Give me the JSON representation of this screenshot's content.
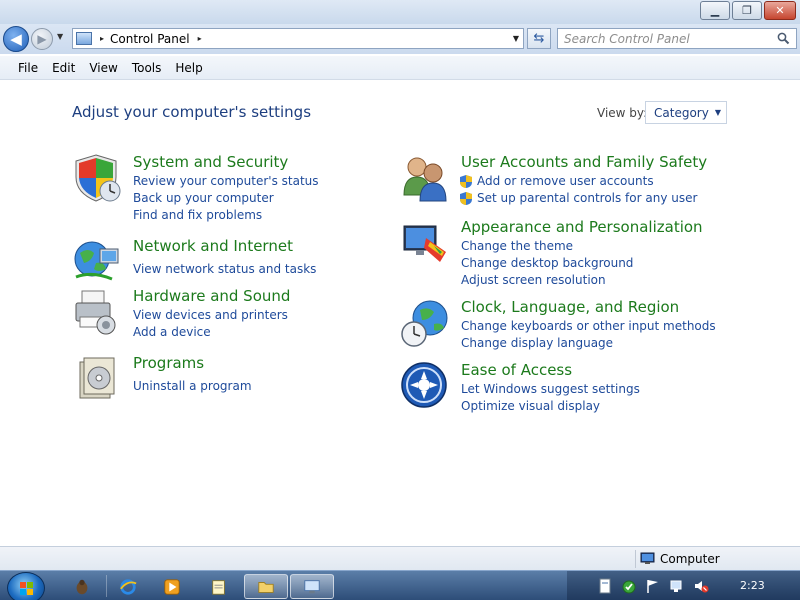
{
  "window": {
    "minimize_glyph": "▁",
    "maximize_glyph": "❐",
    "close_glyph": "✕"
  },
  "navigation": {
    "back_glyph": "◀",
    "forward_glyph": "▶",
    "breadcrumb_separator": "▸",
    "address_text": "Control Panel",
    "refresh_glyph": "⇆",
    "search_placeholder": "Search Control Panel"
  },
  "menu": {
    "items": [
      {
        "label": "File"
      },
      {
        "label": "Edit"
      },
      {
        "label": "View"
      },
      {
        "label": "Tools"
      },
      {
        "label": "Help"
      }
    ]
  },
  "content": {
    "title": "Adjust your computer's settings",
    "view_by_label": "View by:",
    "view_by_value": "Category",
    "categories": [
      {
        "title": "System and Security",
        "icon": "shield-icon",
        "links": [
          "Review your computer's status",
          "Back up your computer",
          "Find and fix problems"
        ]
      },
      {
        "title": "Network and Internet",
        "icon": "network-globe-icon",
        "links": [
          "View network status and tasks"
        ]
      },
      {
        "title": "Hardware and Sound",
        "icon": "printer-icon",
        "links": [
          "View devices and printers",
          "Add a device"
        ]
      },
      {
        "title": "Programs",
        "icon": "programs-icon",
        "links": [
          "Uninstall a program"
        ]
      },
      {
        "title": "User Accounts and Family Safety",
        "icon": "users-icon",
        "links": [
          "Add or remove user accounts",
          "Set up parental controls for any user"
        ]
      },
      {
        "title": "Appearance and Personalization",
        "icon": "monitor-palette-icon",
        "links": [
          "Change the theme",
          "Change desktop background",
          "Adjust screen resolution"
        ]
      },
      {
        "title": "Clock, Language, and Region",
        "icon": "clock-globe-icon",
        "links": [
          "Change keyboards or other input methods",
          "Change display language"
        ]
      },
      {
        "title": "Ease of Access",
        "icon": "ease-of-access-icon",
        "links": [
          "Let Windows suggest settings",
          "Optimize visual display"
        ]
      }
    ]
  },
  "status_bar": {
    "text": "Computer"
  },
  "taskbar": {
    "clock": "2:23"
  },
  "colors": {
    "title_blue": "#1e3f80",
    "category_green": "#1c7a1c",
    "link_blue": "#1e4a9a"
  }
}
